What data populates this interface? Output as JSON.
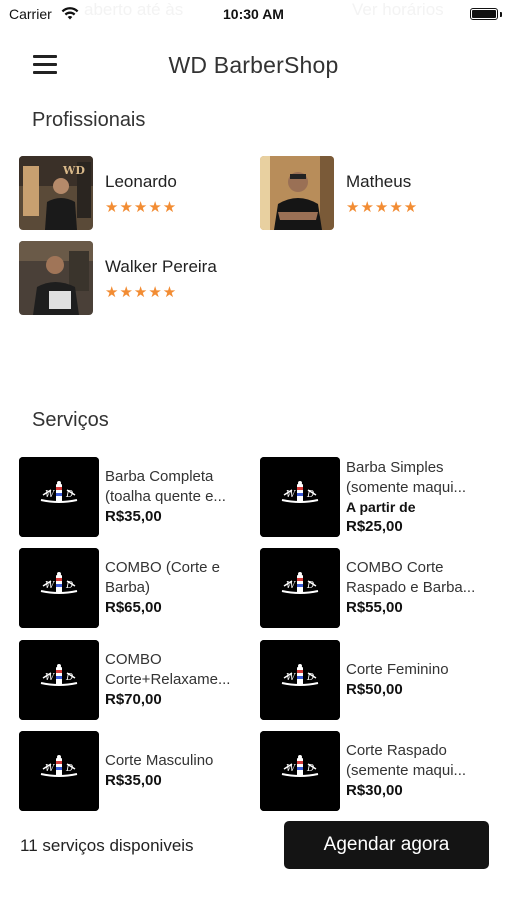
{
  "status_bar": {
    "carrier": "Carrier",
    "time": "10:30 AM",
    "ghost_left": "aberto até às",
    "ghost_right": "Ver horários"
  },
  "header": {
    "title": "WD BarberShop",
    "menu_icon": "hamburger-menu-icon"
  },
  "professionals": {
    "title": "Profissionais",
    "items": [
      {
        "name": "Leonardo",
        "rating": 5,
        "stars": "★★★★★"
      },
      {
        "name": "Matheus",
        "rating": 5,
        "stars": "★★★★★"
      },
      {
        "name": "Walker Pereira",
        "rating": 5,
        "stars": "★★★★★"
      }
    ]
  },
  "services": {
    "title": "Serviços",
    "items": [
      {
        "name": "Barba Completa (toalha quente e...",
        "from": "",
        "price": "R$35,00"
      },
      {
        "name": "Barba Simples (somente maqui...",
        "from": "A partir de",
        "price": "R$25,00"
      },
      {
        "name": "COMBO (Corte e Barba)",
        "from": "",
        "price": "R$65,00"
      },
      {
        "name": "COMBO Corte Raspado e Barba...",
        "from": "",
        "price": "R$55,00"
      },
      {
        "name": "COMBO Corte+Relaxame...",
        "from": "",
        "price": "R$70,00"
      },
      {
        "name": "Corte Feminino",
        "from": "",
        "price": "R$50,00"
      },
      {
        "name": "Corte Masculino",
        "from": "",
        "price": "R$35,00"
      },
      {
        "name": "Corte Raspado (semente maqui...",
        "from": "",
        "price": "R$30,00"
      }
    ]
  },
  "footer": {
    "services_count": "11 serviços disponiveis",
    "schedule_button": "Agendar agora"
  },
  "colors": {
    "star": "#f28c33",
    "button_bg": "#141414",
    "logo_bg": "#000000"
  }
}
